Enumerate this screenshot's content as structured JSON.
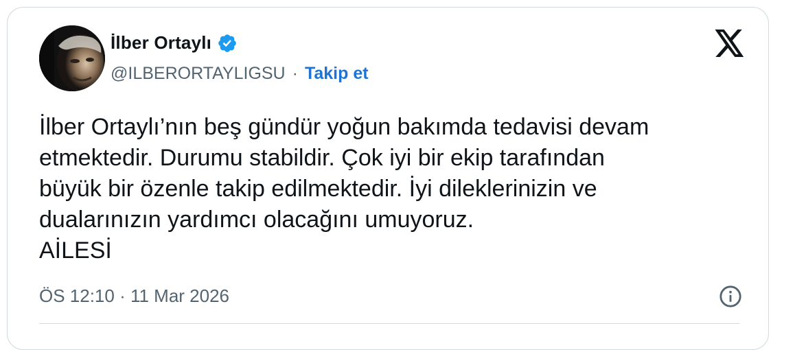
{
  "author": {
    "name": "İlber Ortaylı",
    "handle": "@ILBERORTAYLIGSU",
    "separator": "·",
    "follow_label": "Takip et"
  },
  "tweet": {
    "lines": [
      "İlber Ortaylı’nın beş gündür yoğun bakımda tedavisi devam",
      "etmektedir. Durumu stabildir. Çok iyi bir ekip tarafından",
      "büyük bir özenle takip edilmektedir. İyi dileklerinizin ve",
      "dualarınızın yardımcı olacağını umuyoruz.",
      "AİLESİ"
    ],
    "timestamp": "ÖS 12:10 · 11 Mar 2026"
  },
  "icons": {
    "verified": "verified-badge-icon",
    "platform_logo": "x-logo-icon",
    "info": "info-icon"
  },
  "colors": {
    "text": "#0f1419",
    "secondary": "#536471",
    "link": "#1d74d4",
    "verified": "#1d9bf0",
    "border": "#cfd9de"
  }
}
